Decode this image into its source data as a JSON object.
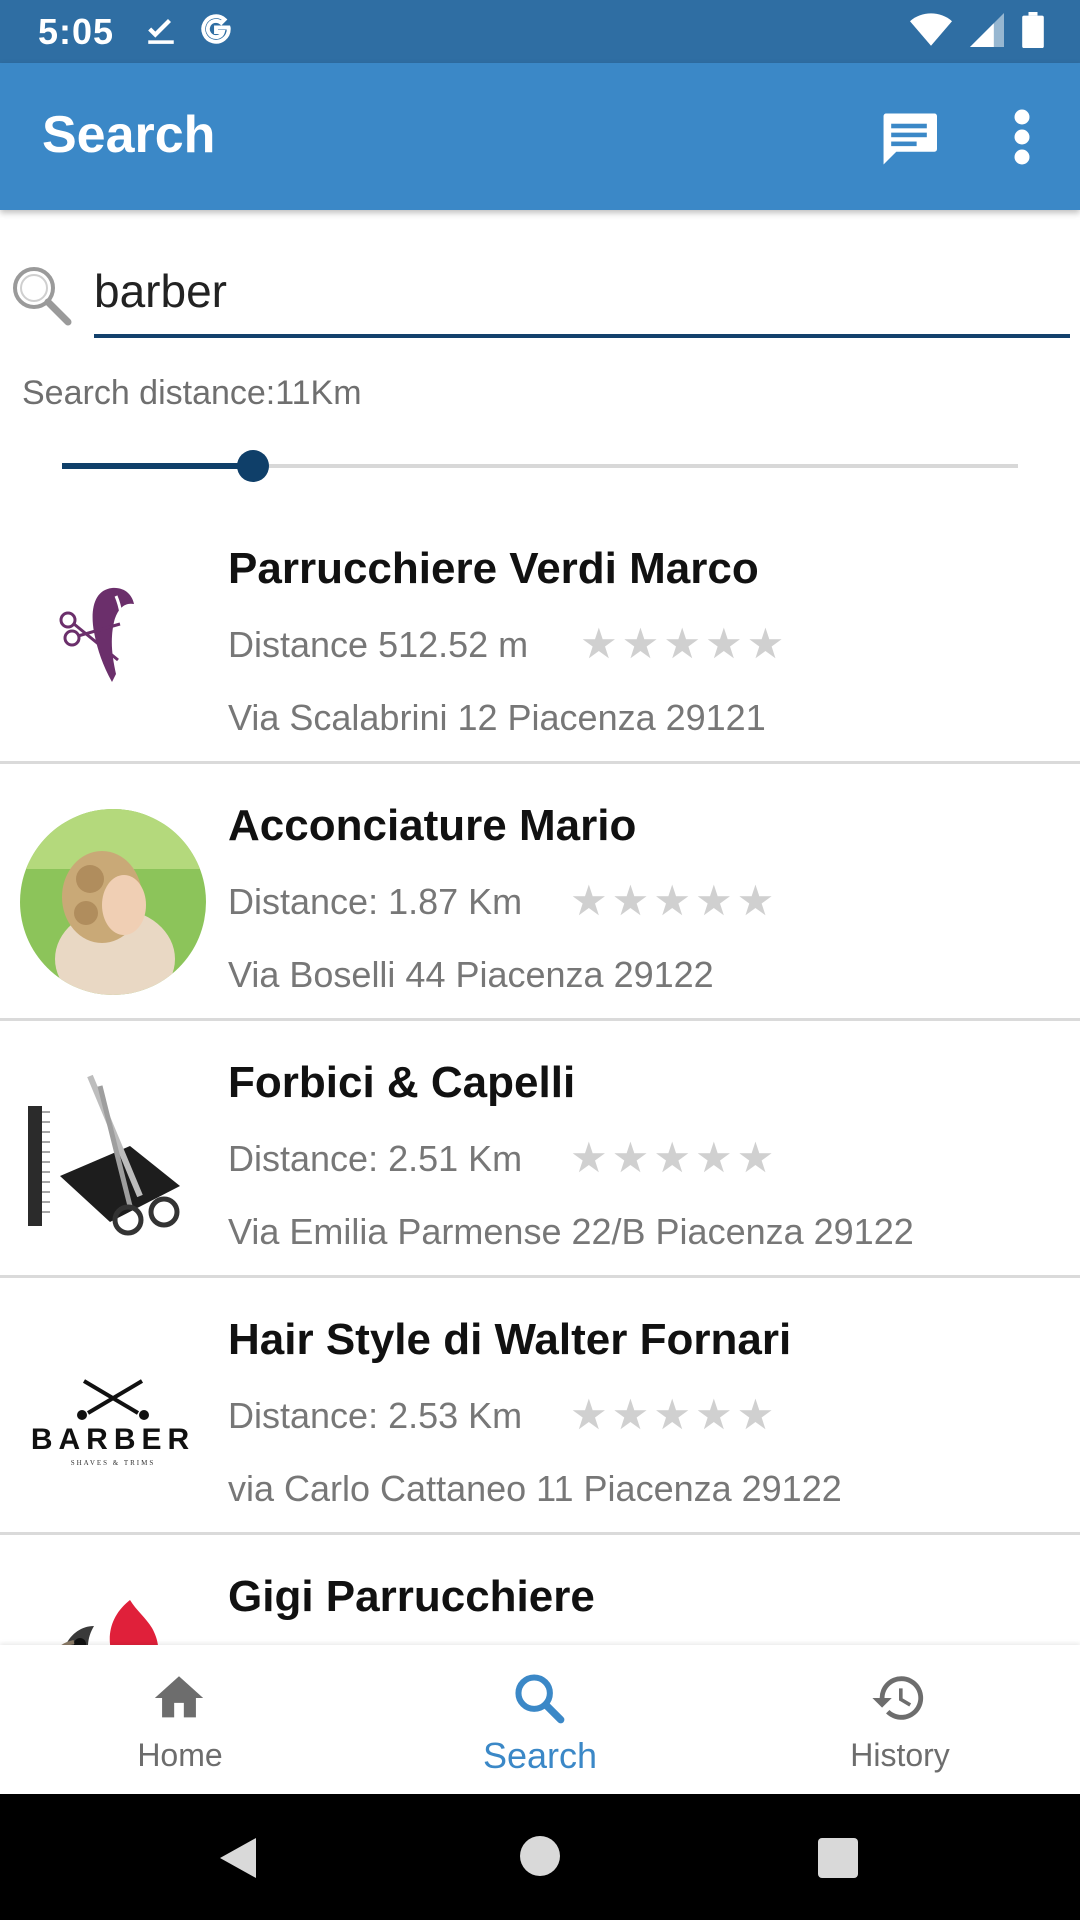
{
  "status_bar": {
    "time": "5:05",
    "left_icons": [
      "download-done-icon",
      "google-g-icon"
    ],
    "right_icons": [
      "wifi-icon",
      "signal-icon",
      "battery-icon"
    ]
  },
  "app_bar": {
    "title": "Search",
    "actions": [
      "chat-icon",
      "more-vert-icon"
    ],
    "color": "#3b88c7"
  },
  "search": {
    "value": "barber",
    "distance_label": "Search distance:11Km",
    "slider_value_fraction": 0.2,
    "accent": "#0f3f69"
  },
  "results": [
    {
      "name": "Parrucchiere Verdi Marco",
      "distance": "Distance 512.52 m",
      "address": "Via Scalabrini 12 Piacenza 29121",
      "rating": 0,
      "max_rating": 5,
      "thumb": "scissors-hair-logo"
    },
    {
      "name": "Acconciature Mario",
      "distance": "Distance: 1.87 Km",
      "address": "Via Boselli 44 Piacenza 29122",
      "rating": 0,
      "max_rating": 5,
      "thumb": "bride-hairstyle-photo"
    },
    {
      "name": "Forbici & Capelli",
      "distance": "Distance: 2.51 Km",
      "address": "Via Emilia Parmense 22/B Piacenza 29122",
      "rating": 0,
      "max_rating": 5,
      "thumb": "scissors-comb-photo"
    },
    {
      "name": "Hair Style di Walter Fornari",
      "distance": "Distance: 2.53 Km",
      "address": "via Carlo Cattaneo 11 Piacenza 29122",
      "rating": 0,
      "max_rating": 5,
      "thumb": "barber-logo",
      "thumb_text": "BARBER",
      "thumb_subtext": "SHAVES & TRIMS"
    },
    {
      "name": "Gigi Parrucchiere",
      "distance": "",
      "address": "",
      "rating": 0,
      "max_rating": 5,
      "thumb": "flame-logo"
    }
  ],
  "bottom_nav": {
    "items": [
      {
        "label": "Home",
        "icon": "home-icon",
        "active": false
      },
      {
        "label": "Search",
        "icon": "search-icon",
        "active": true
      },
      {
        "label": "History",
        "icon": "history-icon",
        "active": false
      }
    ]
  },
  "system_nav": [
    "back-icon",
    "home-circle-icon",
    "recents-icon"
  ]
}
